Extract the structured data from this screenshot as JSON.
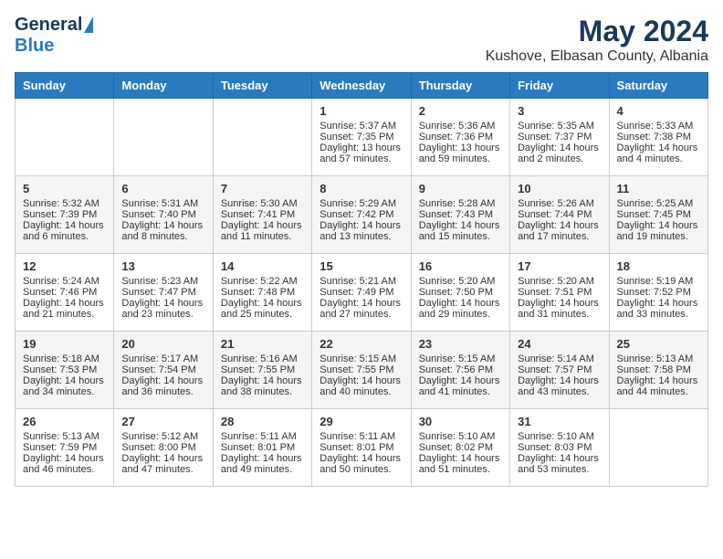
{
  "header": {
    "logo_general": "General",
    "logo_blue": "Blue",
    "month_title": "May 2024",
    "location": "Kushove, Elbasan County, Albania"
  },
  "days_of_week": [
    "Sunday",
    "Monday",
    "Tuesday",
    "Wednesday",
    "Thursday",
    "Friday",
    "Saturday"
  ],
  "weeks": [
    [
      {
        "day": "",
        "sunrise": "",
        "sunset": "",
        "daylight": ""
      },
      {
        "day": "",
        "sunrise": "",
        "sunset": "",
        "daylight": ""
      },
      {
        "day": "",
        "sunrise": "",
        "sunset": "",
        "daylight": ""
      },
      {
        "day": "1",
        "sunrise": "Sunrise: 5:37 AM",
        "sunset": "Sunset: 7:35 PM",
        "daylight": "Daylight: 13 hours and 57 minutes."
      },
      {
        "day": "2",
        "sunrise": "Sunrise: 5:36 AM",
        "sunset": "Sunset: 7:36 PM",
        "daylight": "Daylight: 13 hours and 59 minutes."
      },
      {
        "day": "3",
        "sunrise": "Sunrise: 5:35 AM",
        "sunset": "Sunset: 7:37 PM",
        "daylight": "Daylight: 14 hours and 2 minutes."
      },
      {
        "day": "4",
        "sunrise": "Sunrise: 5:33 AM",
        "sunset": "Sunset: 7:38 PM",
        "daylight": "Daylight: 14 hours and 4 minutes."
      }
    ],
    [
      {
        "day": "5",
        "sunrise": "Sunrise: 5:32 AM",
        "sunset": "Sunset: 7:39 PM",
        "daylight": "Daylight: 14 hours and 6 minutes."
      },
      {
        "day": "6",
        "sunrise": "Sunrise: 5:31 AM",
        "sunset": "Sunset: 7:40 PM",
        "daylight": "Daylight: 14 hours and 8 minutes."
      },
      {
        "day": "7",
        "sunrise": "Sunrise: 5:30 AM",
        "sunset": "Sunset: 7:41 PM",
        "daylight": "Daylight: 14 hours and 11 minutes."
      },
      {
        "day": "8",
        "sunrise": "Sunrise: 5:29 AM",
        "sunset": "Sunset: 7:42 PM",
        "daylight": "Daylight: 14 hours and 13 minutes."
      },
      {
        "day": "9",
        "sunrise": "Sunrise: 5:28 AM",
        "sunset": "Sunset: 7:43 PM",
        "daylight": "Daylight: 14 hours and 15 minutes."
      },
      {
        "day": "10",
        "sunrise": "Sunrise: 5:26 AM",
        "sunset": "Sunset: 7:44 PM",
        "daylight": "Daylight: 14 hours and 17 minutes."
      },
      {
        "day": "11",
        "sunrise": "Sunrise: 5:25 AM",
        "sunset": "Sunset: 7:45 PM",
        "daylight": "Daylight: 14 hours and 19 minutes."
      }
    ],
    [
      {
        "day": "12",
        "sunrise": "Sunrise: 5:24 AM",
        "sunset": "Sunset: 7:46 PM",
        "daylight": "Daylight: 14 hours and 21 minutes."
      },
      {
        "day": "13",
        "sunrise": "Sunrise: 5:23 AM",
        "sunset": "Sunset: 7:47 PM",
        "daylight": "Daylight: 14 hours and 23 minutes."
      },
      {
        "day": "14",
        "sunrise": "Sunrise: 5:22 AM",
        "sunset": "Sunset: 7:48 PM",
        "daylight": "Daylight: 14 hours and 25 minutes."
      },
      {
        "day": "15",
        "sunrise": "Sunrise: 5:21 AM",
        "sunset": "Sunset: 7:49 PM",
        "daylight": "Daylight: 14 hours and 27 minutes."
      },
      {
        "day": "16",
        "sunrise": "Sunrise: 5:20 AM",
        "sunset": "Sunset: 7:50 PM",
        "daylight": "Daylight: 14 hours and 29 minutes."
      },
      {
        "day": "17",
        "sunrise": "Sunrise: 5:20 AM",
        "sunset": "Sunset: 7:51 PM",
        "daylight": "Daylight: 14 hours and 31 minutes."
      },
      {
        "day": "18",
        "sunrise": "Sunrise: 5:19 AM",
        "sunset": "Sunset: 7:52 PM",
        "daylight": "Daylight: 14 hours and 33 minutes."
      }
    ],
    [
      {
        "day": "19",
        "sunrise": "Sunrise: 5:18 AM",
        "sunset": "Sunset: 7:53 PM",
        "daylight": "Daylight: 14 hours and 34 minutes."
      },
      {
        "day": "20",
        "sunrise": "Sunrise: 5:17 AM",
        "sunset": "Sunset: 7:54 PM",
        "daylight": "Daylight: 14 hours and 36 minutes."
      },
      {
        "day": "21",
        "sunrise": "Sunrise: 5:16 AM",
        "sunset": "Sunset: 7:55 PM",
        "daylight": "Daylight: 14 hours and 38 minutes."
      },
      {
        "day": "22",
        "sunrise": "Sunrise: 5:15 AM",
        "sunset": "Sunset: 7:55 PM",
        "daylight": "Daylight: 14 hours and 40 minutes."
      },
      {
        "day": "23",
        "sunrise": "Sunrise: 5:15 AM",
        "sunset": "Sunset: 7:56 PM",
        "daylight": "Daylight: 14 hours and 41 minutes."
      },
      {
        "day": "24",
        "sunrise": "Sunrise: 5:14 AM",
        "sunset": "Sunset: 7:57 PM",
        "daylight": "Daylight: 14 hours and 43 minutes."
      },
      {
        "day": "25",
        "sunrise": "Sunrise: 5:13 AM",
        "sunset": "Sunset: 7:58 PM",
        "daylight": "Daylight: 14 hours and 44 minutes."
      }
    ],
    [
      {
        "day": "26",
        "sunrise": "Sunrise: 5:13 AM",
        "sunset": "Sunset: 7:59 PM",
        "daylight": "Daylight: 14 hours and 46 minutes."
      },
      {
        "day": "27",
        "sunrise": "Sunrise: 5:12 AM",
        "sunset": "Sunset: 8:00 PM",
        "daylight": "Daylight: 14 hours and 47 minutes."
      },
      {
        "day": "28",
        "sunrise": "Sunrise: 5:11 AM",
        "sunset": "Sunset: 8:01 PM",
        "daylight": "Daylight: 14 hours and 49 minutes."
      },
      {
        "day": "29",
        "sunrise": "Sunrise: 5:11 AM",
        "sunset": "Sunset: 8:01 PM",
        "daylight": "Daylight: 14 hours and 50 minutes."
      },
      {
        "day": "30",
        "sunrise": "Sunrise: 5:10 AM",
        "sunset": "Sunset: 8:02 PM",
        "daylight": "Daylight: 14 hours and 51 minutes."
      },
      {
        "day": "31",
        "sunrise": "Sunrise: 5:10 AM",
        "sunset": "Sunset: 8:03 PM",
        "daylight": "Daylight: 14 hours and 53 minutes."
      },
      {
        "day": "",
        "sunrise": "",
        "sunset": "",
        "daylight": ""
      }
    ]
  ]
}
